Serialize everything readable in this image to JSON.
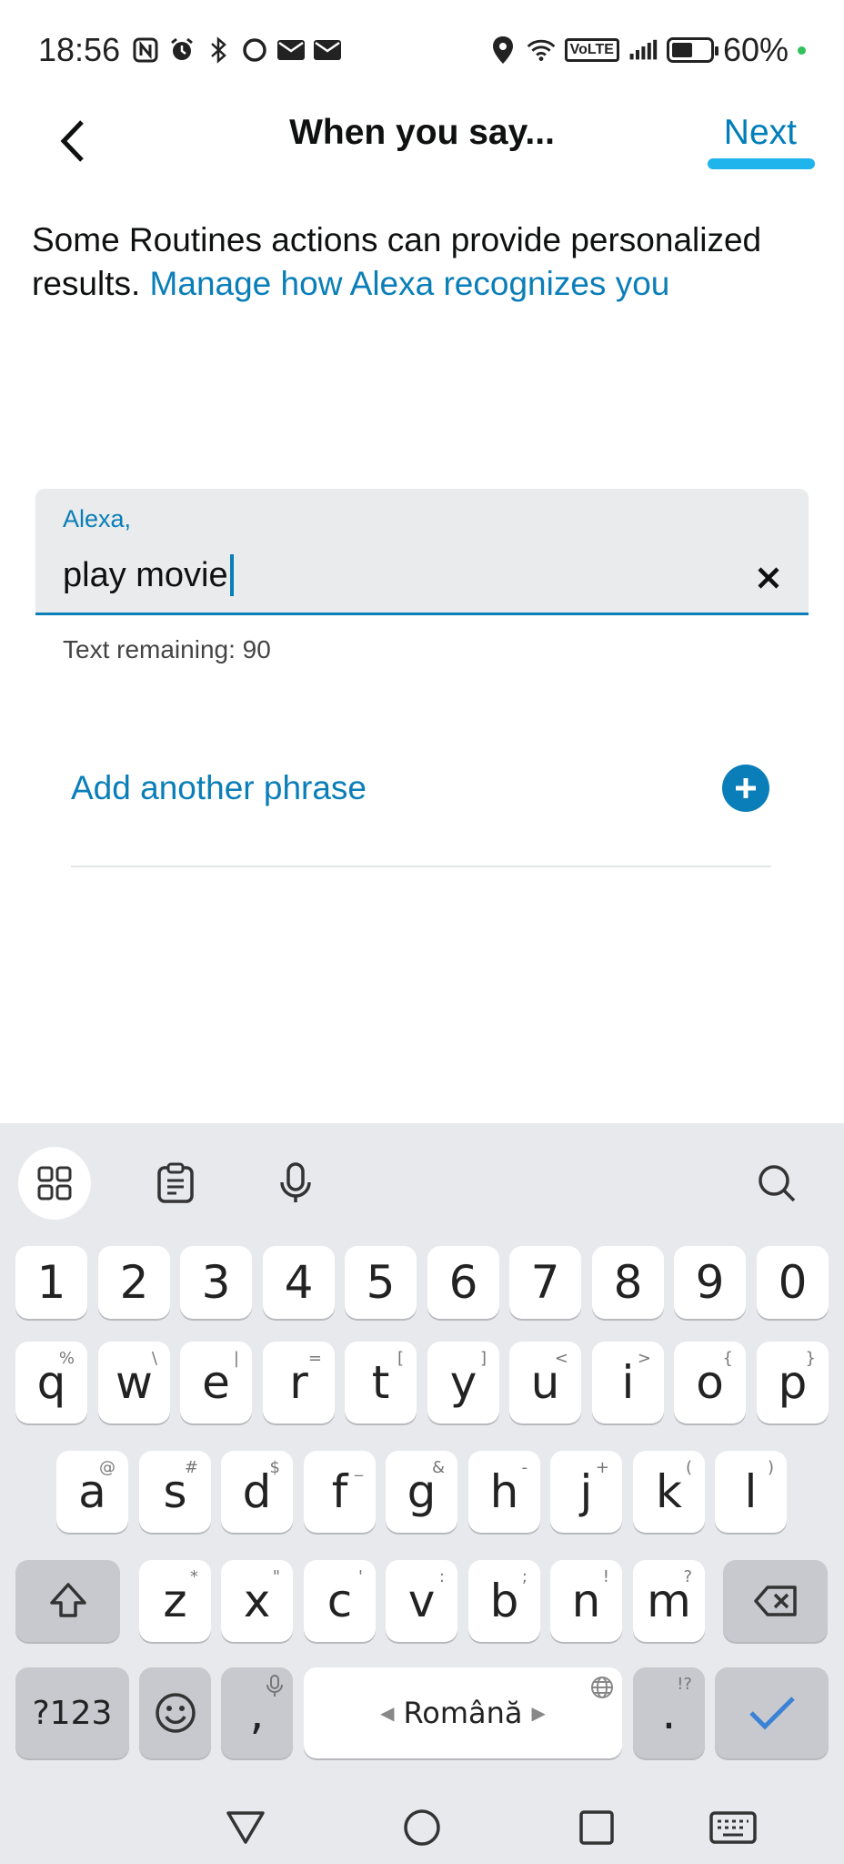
{
  "status_bar": {
    "time": "18:56",
    "battery_percent": "60%",
    "volte": "VoLTE",
    "left_icons": [
      "nfc-icon",
      "alarm-icon",
      "bluetooth-icon",
      "circle-icon",
      "mail-icon",
      "mail-icon"
    ],
    "right_icons": [
      "location-icon",
      "wifi-icon",
      "volte-icon",
      "signal-icon",
      "battery-icon"
    ]
  },
  "header": {
    "title": "When you say...",
    "next_label": "Next",
    "back_icon": "chevron-left-icon",
    "accent": "#007eb9",
    "underline_color": "#1fb4ec"
  },
  "intro": {
    "text": "Some Routines actions can provide personalized results. ",
    "link": "Manage how Alexa recognizes you"
  },
  "phrase_field": {
    "label": "Alexa,",
    "value": "play movie",
    "clear_icon": "close-icon"
  },
  "remaining": "Text remaining: 90",
  "add_phrase": {
    "label": "Add another phrase",
    "icon": "plus-circle-icon"
  },
  "keyboard": {
    "toolbar": [
      "apps-grid-icon",
      "clipboard-icon",
      "microphone-icon",
      "search-icon"
    ],
    "number_row": [
      "1",
      "2",
      "3",
      "4",
      "5",
      "6",
      "7",
      "8",
      "9",
      "0"
    ],
    "row1": [
      {
        "k": "q",
        "h": "%"
      },
      {
        "k": "w",
        "h": "\\"
      },
      {
        "k": "e",
        "h": "|"
      },
      {
        "k": "r",
        "h": "="
      },
      {
        "k": "t",
        "h": "["
      },
      {
        "k": "y",
        "h": "]"
      },
      {
        "k": "u",
        "h": "<"
      },
      {
        "k": "i",
        "h": ">"
      },
      {
        "k": "o",
        "h": "{"
      },
      {
        "k": "p",
        "h": "}"
      }
    ],
    "row2": [
      {
        "k": "a",
        "h": "@"
      },
      {
        "k": "s",
        "h": "#"
      },
      {
        "k": "d",
        "h": "$"
      },
      {
        "k": "f",
        "h": "_"
      },
      {
        "k": "g",
        "h": "&"
      },
      {
        "k": "h",
        "h": "-"
      },
      {
        "k": "j",
        "h": "+"
      },
      {
        "k": "k",
        "h": "("
      },
      {
        "k": "l",
        "h": ")"
      }
    ],
    "row3": [
      {
        "k": "z",
        "h": "*"
      },
      {
        "k": "x",
        "h": "\""
      },
      {
        "k": "c",
        "h": "'"
      },
      {
        "k": "v",
        "h": ":"
      },
      {
        "k": "b",
        "h": ";"
      },
      {
        "k": "n",
        "h": "!"
      },
      {
        "k": "m",
        "h": "?"
      }
    ],
    "symbols_label": "?123",
    "comma_label": ",",
    "space_label": "Română",
    "period_label": ".",
    "period_hint": "!?",
    "check_color": "#3b82d6"
  },
  "navbar": [
    "back-triangle-icon",
    "home-circle-icon",
    "recents-square-icon",
    "keyboard-icon"
  ]
}
